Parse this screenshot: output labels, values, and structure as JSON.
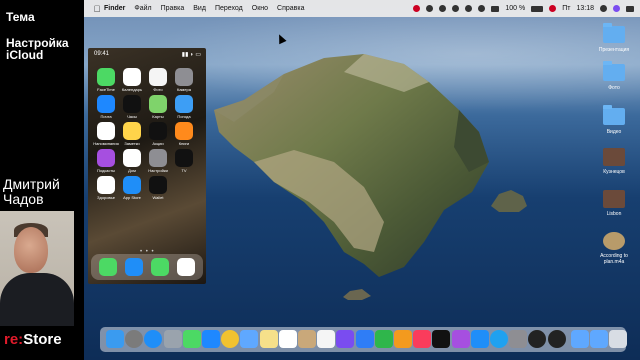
{
  "presenter_panel": {
    "topic_label": "Тема",
    "subject": "Настройка iCloud",
    "presenter_name": "Дмитрий Чадов",
    "brand_prefix": "re:",
    "brand_name": "Store"
  },
  "menubar": {
    "apple_icon": "apple-logo-icon",
    "items": [
      "Finder",
      "Файл",
      "Правка",
      "Вид",
      "Переход",
      "Окно",
      "Справка"
    ],
    "battery": "100 %",
    "day": "Пт",
    "time": "13:18"
  },
  "iphone": {
    "time": "09:41",
    "apps": [
      {
        "name": "FaceTime",
        "label": "FaceTime",
        "color": "#4cd964"
      },
      {
        "name": "calendar",
        "label": "Календарь",
        "color": "#ffffff"
      },
      {
        "name": "photos",
        "label": "Фото",
        "color": "#f5f5f5"
      },
      {
        "name": "camera",
        "label": "Камера",
        "color": "#8e8e93"
      },
      {
        "name": "mail",
        "label": "Почта",
        "color": "#1e88ff"
      },
      {
        "name": "clock",
        "label": "Часы",
        "color": "#111111"
      },
      {
        "name": "maps",
        "label": "Карты",
        "color": "#7fd36b"
      },
      {
        "name": "weather",
        "label": "Погода",
        "color": "#3d9ef5"
      },
      {
        "name": "reminders",
        "label": "Напоминания",
        "color": "#ffffff"
      },
      {
        "name": "notes",
        "label": "Заметки",
        "color": "#ffd44a"
      },
      {
        "name": "stocks",
        "label": "Акции",
        "color": "#111111"
      },
      {
        "name": "books",
        "label": "Книги",
        "color": "#ff8a1c"
      },
      {
        "name": "podcasts",
        "label": "Подкасты",
        "color": "#a64fe0"
      },
      {
        "name": "home",
        "label": "Дом",
        "color": "#ffffff"
      },
      {
        "name": "settings",
        "label": "Настройки",
        "color": "#8e8e93"
      },
      {
        "name": "tv",
        "label": "TV",
        "color": "#111111"
      },
      {
        "name": "health",
        "label": "Здоровье",
        "color": "#ffffff"
      },
      {
        "name": "appstore",
        "label": "App Store",
        "color": "#1f8ef8"
      },
      {
        "name": "wallet",
        "label": "Wallet",
        "color": "#111111"
      }
    ],
    "dock": [
      {
        "name": "phone",
        "color": "#4cd964"
      },
      {
        "name": "safari",
        "color": "#1f8ef8"
      },
      {
        "name": "messages",
        "color": "#4cd964"
      },
      {
        "name": "music",
        "color": "#ffffff"
      }
    ]
  },
  "desktop_items": [
    {
      "label": "Презентация",
      "kind": "folder"
    },
    {
      "label": "Фото",
      "kind": "folder"
    },
    {
      "label": "Видео",
      "kind": "folder"
    },
    {
      "label": "Кузнецов",
      "kind": "image"
    },
    {
      "label": "Lisbon",
      "kind": "image"
    },
    {
      "label": "According to plan.m4a",
      "kind": "audio"
    }
  ],
  "dock_apps": [
    {
      "name": "finder",
      "color": "#3a9bf0"
    },
    {
      "name": "launchpad",
      "color": "#7b7b7b"
    },
    {
      "name": "safari",
      "color": "#1f8ef8"
    },
    {
      "name": "rocket",
      "color": "#9aa3ad"
    },
    {
      "name": "messages",
      "color": "#4cd964"
    },
    {
      "name": "mail",
      "color": "#1e88ff"
    },
    {
      "name": "chrome",
      "color": "#f2c230"
    },
    {
      "name": "preview",
      "color": "#5fa8ff"
    },
    {
      "name": "notes",
      "color": "#f6e08a"
    },
    {
      "name": "calendar",
      "color": "#ffffff"
    },
    {
      "name": "contacts",
      "color": "#c9a87a"
    },
    {
      "name": "photos",
      "color": "#f5f5f5"
    },
    {
      "name": "imovie",
      "color": "#7a4cf0"
    },
    {
      "name": "keynote",
      "color": "#2f7df6"
    },
    {
      "name": "numbers",
      "color": "#2fb64b"
    },
    {
      "name": "pages",
      "color": "#f39a1e"
    },
    {
      "name": "music",
      "color": "#fa3c5c"
    },
    {
      "name": "tv",
      "color": "#111111"
    },
    {
      "name": "podcasts",
      "color": "#a64fe0"
    },
    {
      "name": "appstore",
      "color": "#1f8ef8"
    },
    {
      "name": "skype",
      "color": "#1fa1f0"
    },
    {
      "name": "settings",
      "color": "#8e8e93"
    },
    {
      "name": "speedtest",
      "color": "#222222"
    },
    {
      "name": "mirror",
      "color": "#222222"
    },
    {
      "name": "downloads",
      "color": "#5fa8ff"
    },
    {
      "name": "documents",
      "color": "#5fa8ff"
    },
    {
      "name": "trash",
      "color": "#d8dde4"
    }
  ]
}
